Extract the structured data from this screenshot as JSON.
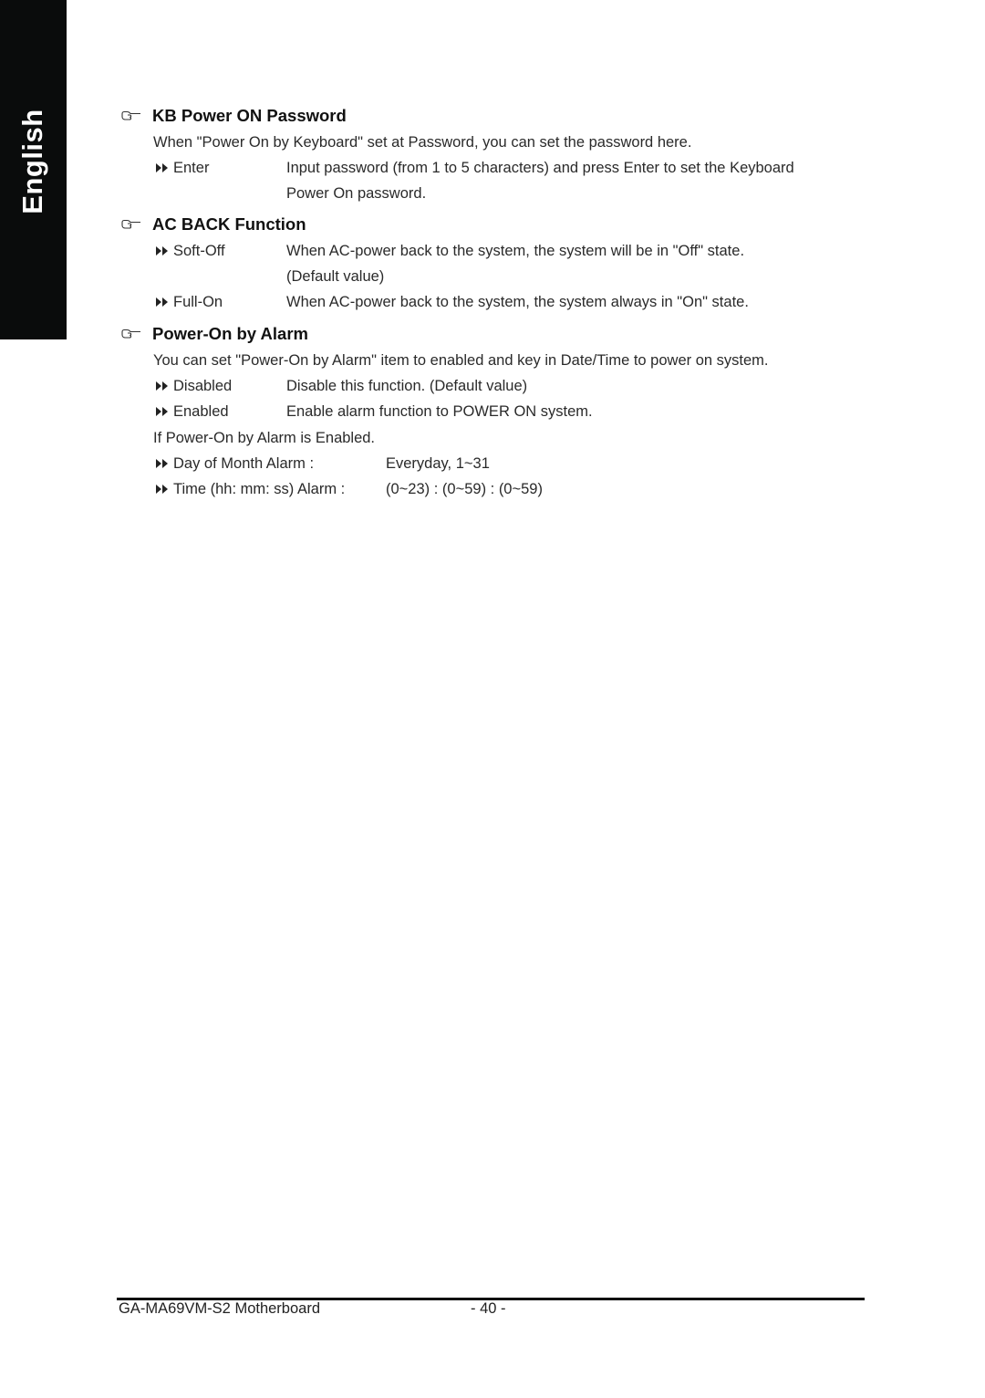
{
  "side_tab": {
    "label": "English"
  },
  "sections": [
    {
      "heading": "KB Power ON Password",
      "intro": "When \"Power On by Keyboard\" set at Password, you can set the password here.",
      "options": [
        {
          "label": "Enter",
          "description_lines": [
            "Input password (from 1 to 5 characters) and press Enter to set the Keyboard",
            "Power On password."
          ]
        }
      ]
    },
    {
      "heading": "AC BACK Function",
      "options": [
        {
          "label": "Soft-Off",
          "description_lines": [
            "When AC-power back to the system, the system will be in \"Off\" state.",
            "(Default value)"
          ]
        },
        {
          "label": "Full-On",
          "description_lines": [
            "When AC-power back to the system, the system always in \"On\" state."
          ]
        }
      ]
    },
    {
      "heading": "Power-On by Alarm",
      "intro": "You can set \"Power-On by Alarm\" item to enabled and key in Date/Time to power on system.",
      "options": [
        {
          "label": "Disabled",
          "description_lines": [
            "Disable this function. (Default value)"
          ]
        },
        {
          "label": "Enabled",
          "description_lines": [
            "Enable alarm function to POWER ON system."
          ]
        }
      ],
      "conditional_note": "If Power-On by Alarm is Enabled.",
      "alarm_settings": [
        {
          "label": "Day of Month Alarm :",
          "value": "Everyday, 1~31"
        },
        {
          "label": "Time (hh: mm: ss) Alarm :",
          "value": "(0~23) : (0~59) : (0~59)"
        }
      ]
    }
  ],
  "footer": {
    "product": "GA-MA69VM-S2 Motherboard",
    "page_number": "- 40 -"
  },
  "icons": {
    "section_bullet": "pointing-hand-icon",
    "option_bullet": "double-arrow-right-icon"
  },
  "colors": {
    "side_tab_bg": "#0a0c0c",
    "side_tab_text": "#ffffff",
    "text": "#222222"
  }
}
